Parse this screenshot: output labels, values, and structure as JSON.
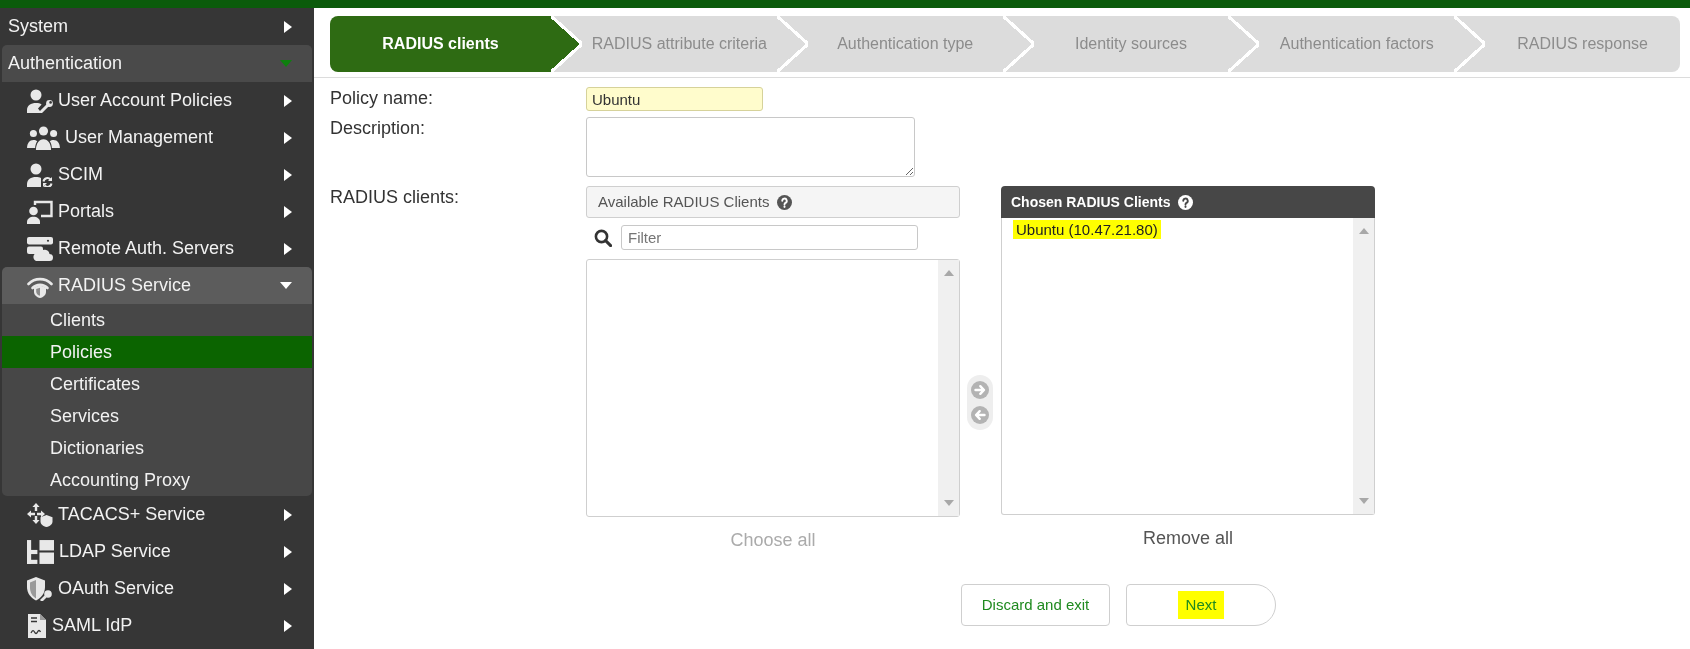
{
  "sidebar": {
    "items": [
      {
        "label": "System",
        "expanded": false
      },
      {
        "label": "Authentication",
        "expanded": true,
        "children": [
          {
            "label": "User Account Policies",
            "expanded": false
          },
          {
            "label": "User Management",
            "expanded": false
          },
          {
            "label": "SCIM",
            "expanded": false
          },
          {
            "label": "Portals",
            "expanded": false
          },
          {
            "label": "Remote Auth. Servers",
            "expanded": false
          },
          {
            "label": "RADIUS Service",
            "expanded": true,
            "children": [
              {
                "label": "Clients",
                "selected": false
              },
              {
                "label": "Policies",
                "selected": true
              },
              {
                "label": "Certificates",
                "selected": false
              },
              {
                "label": "Services",
                "selected": false
              },
              {
                "label": "Dictionaries",
                "selected": false
              },
              {
                "label": "Accounting Proxy",
                "selected": false
              }
            ]
          },
          {
            "label": "TACACS+ Service",
            "expanded": false
          },
          {
            "label": "LDAP Service",
            "expanded": false
          },
          {
            "label": "OAuth Service",
            "expanded": false
          },
          {
            "label": "SAML IdP",
            "expanded": false
          }
        ]
      }
    ]
  },
  "wizard_steps": [
    {
      "label": "RADIUS clients",
      "selected": true
    },
    {
      "label": "RADIUS attribute criteria",
      "selected": false
    },
    {
      "label": "Authentication type",
      "selected": false
    },
    {
      "label": "Identity sources",
      "selected": false
    },
    {
      "label": "Authentication factors",
      "selected": false
    },
    {
      "label": "RADIUS response",
      "selected": false
    }
  ],
  "form": {
    "policy_name": {
      "label": "Policy name:",
      "value": "Ubuntu"
    },
    "description": {
      "label": "Description:"
    },
    "radius_clients": {
      "label": "RADIUS clients:",
      "available": {
        "title": "Available RADIUS Clients",
        "filter": {
          "placeholder": "Filter"
        },
        "action": {
          "label": "Choose all",
          "disabled": true
        }
      },
      "chosen": {
        "title": "Chosen RADIUS Clients",
        "items": [
          {
            "label": "Ubuntu (10.47.21.80)",
            "highlighted": true
          }
        ],
        "action": {
          "label": "Remove all",
          "disabled": false
        }
      }
    }
  },
  "buttons": [
    {
      "label": "Discard and exit",
      "kind": "exit",
      "highlighted": false
    },
    {
      "label": "Next",
      "kind": "next",
      "highlighted": true
    }
  ]
}
